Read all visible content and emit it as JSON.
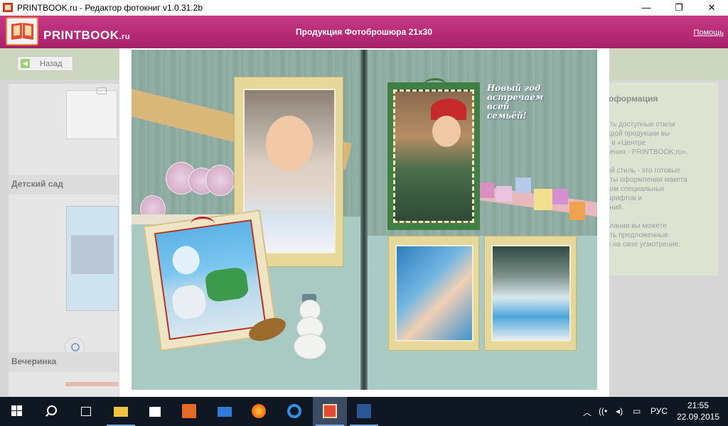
{
  "window": {
    "title": "PRINTBOOK.ru - Редактор фотокниг v1.0.31.2b",
    "controls": {
      "minimize": "—",
      "maximize": "❐",
      "close": "✕"
    }
  },
  "header": {
    "logo_main": "PRINTBOOK",
    "logo_suffix": ".ru",
    "title": "Продукция Фотоброшюра 21x30",
    "help": "Помощь"
  },
  "toolbar": {
    "back_label": "Назад"
  },
  "left_panel": {
    "sections": [
      {
        "label": "Детский сад"
      },
      {
        "label": "Вечеринка"
      }
    ]
  },
  "right_panel": {
    "title": "оформация",
    "text": "ить доступные стили\nждой продукции вы\nе в «Центре\nления - PRINTBOOK.ru».\n\nый стиль - это готовые\nнты оформления макета\nром специальных\n шрифтов и\nений.\n\nелании вы можете\nить предложенные\nы на свое усмотрение."
  },
  "book": {
    "caption": "Новый год\nвстречаем всей\nсемьёй!"
  },
  "taskbar": {
    "language": "РУС",
    "time": "21:55",
    "date": "22.09.2015",
    "colors": {
      "background": "#0f1723",
      "active": "#3a4b62",
      "accent": "#78a9e2"
    }
  }
}
